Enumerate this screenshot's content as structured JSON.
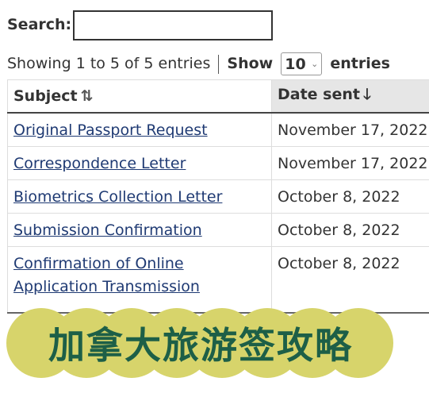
{
  "search": {
    "label": "Search:",
    "value": ""
  },
  "info": {
    "showing": "Showing 1 to 5 of 5 entries",
    "show": "Show",
    "page_length": "10",
    "entries": "entries"
  },
  "table": {
    "headers": [
      {
        "label": "Subject",
        "icon": "sort-both-icon"
      },
      {
        "label": "Date sent",
        "icon": "sort-desc-arrow-icon"
      }
    ],
    "rows": [
      {
        "subject": "Original Passport Request",
        "date": "November 17, 2022"
      },
      {
        "subject": "Correspondence Letter",
        "date": "November 17, 2022"
      },
      {
        "subject": "Biometrics Collection Letter",
        "date": "October 8, 2022"
      },
      {
        "subject": "Submission Confirmation",
        "date": "October 8, 2022"
      },
      {
        "subject": "Confirmation of Online Application Transmission",
        "date": "October 8, 2022"
      }
    ]
  },
  "banner": {
    "text": "加拿大旅游签攻略",
    "bg": "#d7d46b",
    "color": "#1d5f47"
  }
}
